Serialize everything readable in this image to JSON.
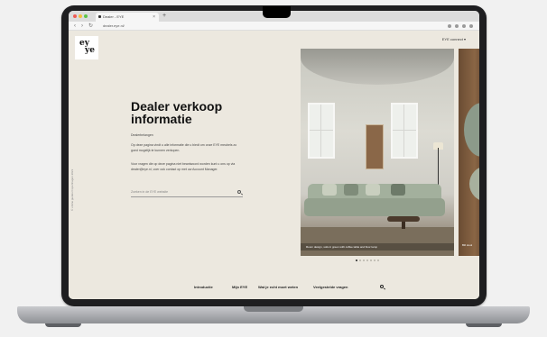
{
  "browser": {
    "tab_title": "Dealer - EYE",
    "new_tab_symbol": "+",
    "url": "dealer.eye.nl/",
    "back_symbol": "‹",
    "forward_symbol": "›",
    "reload_symbol": "↻"
  },
  "site": {
    "logo_line1": "ey",
    "logo_line2": "ye",
    "language_selector": "EYE connect ▾",
    "side_caption": "© online guides Copenhagen 2023"
  },
  "hero": {
    "title": "Dealer verkoop informatie",
    "subtitle": "Dealerbelangen",
    "paragraph1": "Op deze pagina vindt u alle informatie die u biedt om onze EYE meubels zo goed mogelijk te kunnen verkopen.",
    "paragraph2": "Voor vragen die op deze pagina niet beantwoord worden kunt u ons op via dealer@eye.nl, voer ook contact op met uw Account Manager.",
    "search_placeholder": "Zoeken in de EYE website"
  },
  "carousel": {
    "slide1_caption": "Room design, sofa in green with coffee table and floor lamp",
    "slide2_caption": "Bill stool",
    "slide_count": 7,
    "active_index": 0
  },
  "footer_nav": {
    "items": [
      "Introductie",
      "Mijn EYE",
      "Wat je echt moet weten",
      "Veelgestelde vragen"
    ],
    "back_to_top": "↑"
  }
}
